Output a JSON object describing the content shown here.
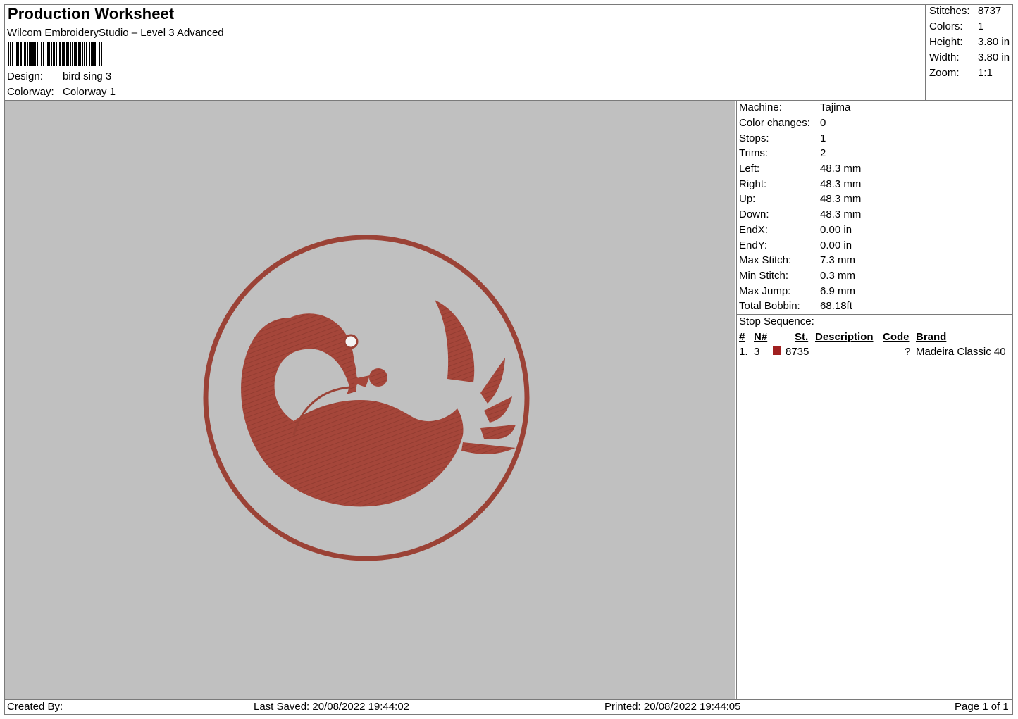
{
  "header": {
    "title": "Production Worksheet",
    "subtitle": "Wilcom EmbroideryStudio – Level 3 Advanced",
    "design_label": "Design:",
    "design_value": "bird sing 3",
    "colorway_label": "Colorway:",
    "colorway_value": "Colorway 1"
  },
  "summary": [
    {
      "label": "Stitches:",
      "value": "8737"
    },
    {
      "label": "Colors:",
      "value": "1"
    },
    {
      "label": "Height:",
      "value": "3.80 in"
    },
    {
      "label": "Width:",
      "value": "3.80 in"
    },
    {
      "label": "Zoom:",
      "value": "1:1"
    }
  ],
  "machine_info": [
    {
      "label": "Machine:",
      "value": "Tajima"
    },
    {
      "label": "Color changes:",
      "value": "0"
    },
    {
      "label": "Stops:",
      "value": "1"
    },
    {
      "label": "Trims:",
      "value": "2"
    },
    {
      "label": "Left:",
      "value": "48.3 mm"
    },
    {
      "label": "Right:",
      "value": "48.3 mm"
    },
    {
      "label": "Up:",
      "value": "48.3 mm"
    },
    {
      "label": "Down:",
      "value": "48.3 mm"
    },
    {
      "label": "EndX:",
      "value": "0.00 in"
    },
    {
      "label": "EndY:",
      "value": "0.00 in"
    },
    {
      "label": "Max Stitch:",
      "value": "7.3 mm"
    },
    {
      "label": "Min Stitch:",
      "value": "0.3 mm"
    },
    {
      "label": "Max Jump:",
      "value": "6.9 mm"
    },
    {
      "label": "Total Bobbin:",
      "value": "68.18ft"
    }
  ],
  "stop_sequence": {
    "title": "Stop Sequence:",
    "columns": {
      "num": "#",
      "n": "N#",
      "st": "St.",
      "description": "Description",
      "code": "Code",
      "brand": "Brand"
    },
    "rows": [
      {
        "num": "1.",
        "n": "3",
        "st": "8735",
        "description": "",
        "code": "?",
        "brand": "Madeira Classic 40",
        "color": "#a02020"
      }
    ]
  },
  "footer": {
    "created_by": "Created By:",
    "last_saved": "Last Saved: 20/08/2022 19:44:02",
    "printed": "Printed: 20/08/2022 19:44:05",
    "page": "Page 1 of 1"
  },
  "colors": {
    "thread": "#a5463a",
    "canvas": "#c0c0c0"
  }
}
